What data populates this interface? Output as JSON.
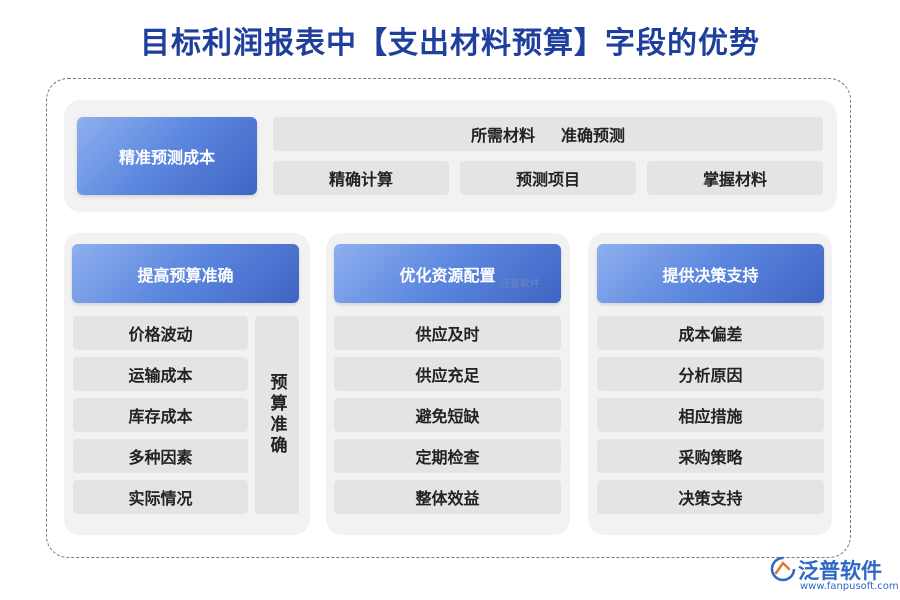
{
  "title": "目标利润报表中【支出材料预算】字段的优势",
  "top": {
    "header": "精准预测成本",
    "row1": [
      "所需材料",
      "准确预测"
    ],
    "row2": [
      "精确计算",
      "预测项目",
      "掌握材料"
    ]
  },
  "col1": {
    "header": "提高预算准确",
    "items": [
      "价格波动",
      "运输成本",
      "库存成本",
      "多种因素",
      "实际情况"
    ],
    "side": "预算准确"
  },
  "col2": {
    "header": "优化资源配置",
    "items": [
      "供应及时",
      "供应充足",
      "避免短缺",
      "定期检查",
      "整体效益"
    ]
  },
  "col3": {
    "header": "提供决策支持",
    "items": [
      "成本偏差",
      "分析原因",
      "相应措施",
      "采购策略",
      "决策支持"
    ]
  },
  "watermark": "泛普软件",
  "brand": {
    "name": "泛普软件",
    "url": "www.fanpusoft.com",
    "color": "#2f67c6"
  }
}
